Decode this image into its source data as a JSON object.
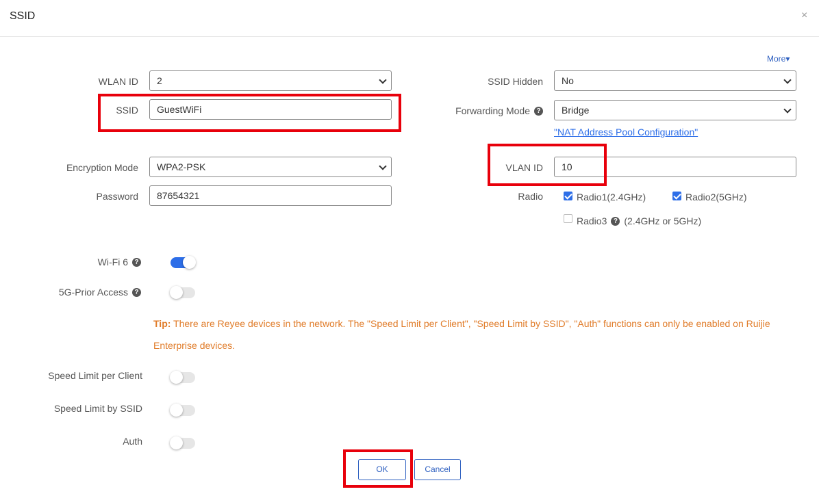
{
  "dialog": {
    "title": "SSID",
    "close": "×",
    "more": "More▾"
  },
  "left": {
    "wlan_id": {
      "label": "WLAN ID",
      "value": "2"
    },
    "ssid": {
      "label": "SSID",
      "value": "GuestWiFi"
    },
    "encryption": {
      "label": "Encryption Mode",
      "value": "WPA2-PSK"
    },
    "password": {
      "label": "Password",
      "value": "87654321"
    }
  },
  "right": {
    "ssid_hidden": {
      "label": "SSID Hidden",
      "value": "No"
    },
    "forwarding": {
      "label": "Forwarding Mode",
      "value": "Bridge",
      "link": "\"NAT Address Pool Configuration\""
    },
    "vlan_id": {
      "label": "VLAN ID",
      "value": "10"
    },
    "radio": {
      "label": "Radio",
      "options": [
        {
          "label": "Radio1(2.4GHz)",
          "checked": true
        },
        {
          "label": "Radio2(5GHz)",
          "checked": true
        },
        {
          "label": "Radio3",
          "suffix": "(2.4GHz or 5GHz)",
          "checked": false
        }
      ]
    }
  },
  "toggles": [
    {
      "label": "Wi-Fi 6",
      "on": true,
      "help": true
    },
    {
      "label": "5G-Prior Access",
      "on": false,
      "help": true
    },
    {
      "label": "Speed Limit per Client",
      "on": false
    },
    {
      "label": "Speed Limit by SSID",
      "on": false
    },
    {
      "label": "Auth",
      "on": false
    }
  ],
  "tip": {
    "prefix": "Tip:",
    "text": " There are Reyee devices in the network. The \"Speed Limit per Client\", \"Speed Limit by SSID\", \"Auth\" functions can only be enabled on Ruijie Enterprise devices."
  },
  "help_glyph": "?",
  "buttons": {
    "ok": "OK",
    "cancel": "Cancel"
  },
  "colors": {
    "accent": "#2d6ee8",
    "tip": "#e07b28",
    "highlight": "#e8000b"
  }
}
